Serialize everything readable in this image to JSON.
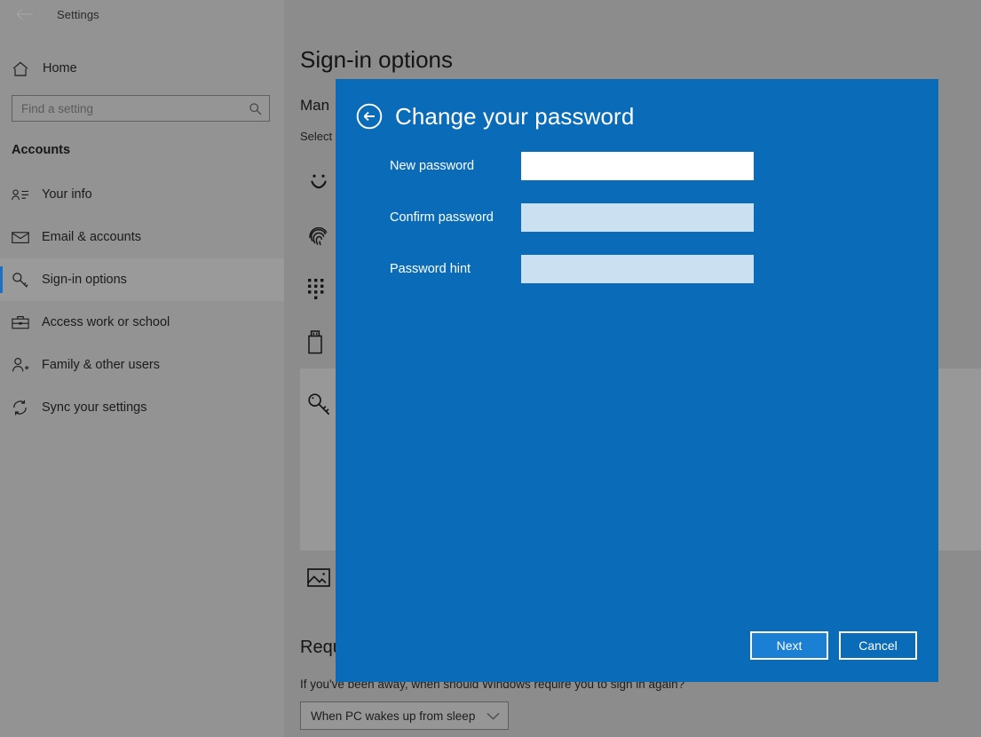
{
  "window": {
    "title": "Settings",
    "back_icon": "back-arrow-icon"
  },
  "sidebar": {
    "home_label": "Home",
    "home_icon": "home-icon",
    "search": {
      "placeholder": "Find a setting",
      "value": "",
      "icon": "search-icon"
    },
    "section_title": "Accounts",
    "items": [
      {
        "label": "Your info",
        "icon": "contact-card-icon",
        "selected": false
      },
      {
        "label": "Email & accounts",
        "icon": "envelope-icon",
        "selected": false
      },
      {
        "label": "Sign-in options",
        "icon": "key-icon",
        "selected": true
      },
      {
        "label": "Access work or school",
        "icon": "briefcase-icon",
        "selected": false
      },
      {
        "label": "Family & other users",
        "icon": "person-add-icon",
        "selected": false
      },
      {
        "label": "Sync your settings",
        "icon": "sync-icon",
        "selected": false
      }
    ]
  },
  "main": {
    "page_title": "Sign-in options",
    "manage_heading": "Man",
    "select_text": "Select",
    "options": [
      {
        "icon": "windows-hello-face-icon"
      },
      {
        "icon": "fingerprint-icon"
      },
      {
        "icon": "pin-keypad-icon"
      },
      {
        "icon": "security-key-icon"
      },
      {
        "icon": "password-key-icon",
        "expanded": true
      },
      {
        "icon": "picture-password-icon"
      }
    ],
    "require_heading": "Requ",
    "require_text": "If you've been away, when should Windows require you to sign in again?",
    "require_dropdown": {
      "value": "When PC wakes up from sleep",
      "chevron_icon": "chevron-down-icon"
    }
  },
  "dialog": {
    "back_icon": "circle-back-arrow-icon",
    "title": "Change your password",
    "fields": [
      {
        "label": "New password",
        "value": "",
        "focused": true
      },
      {
        "label": "Confirm password",
        "value": "",
        "focused": false
      },
      {
        "label": "Password hint",
        "value": "",
        "focused": false
      }
    ],
    "next_label": "Next",
    "cancel_label": "Cancel"
  },
  "colors": {
    "dialog_blue": "#0a6cb8",
    "primary_button": "#1b7fd4",
    "accent_bar": "#1c6fc4",
    "field_unfocused": "#cbe0f0",
    "field_focused": "#ffffff"
  }
}
